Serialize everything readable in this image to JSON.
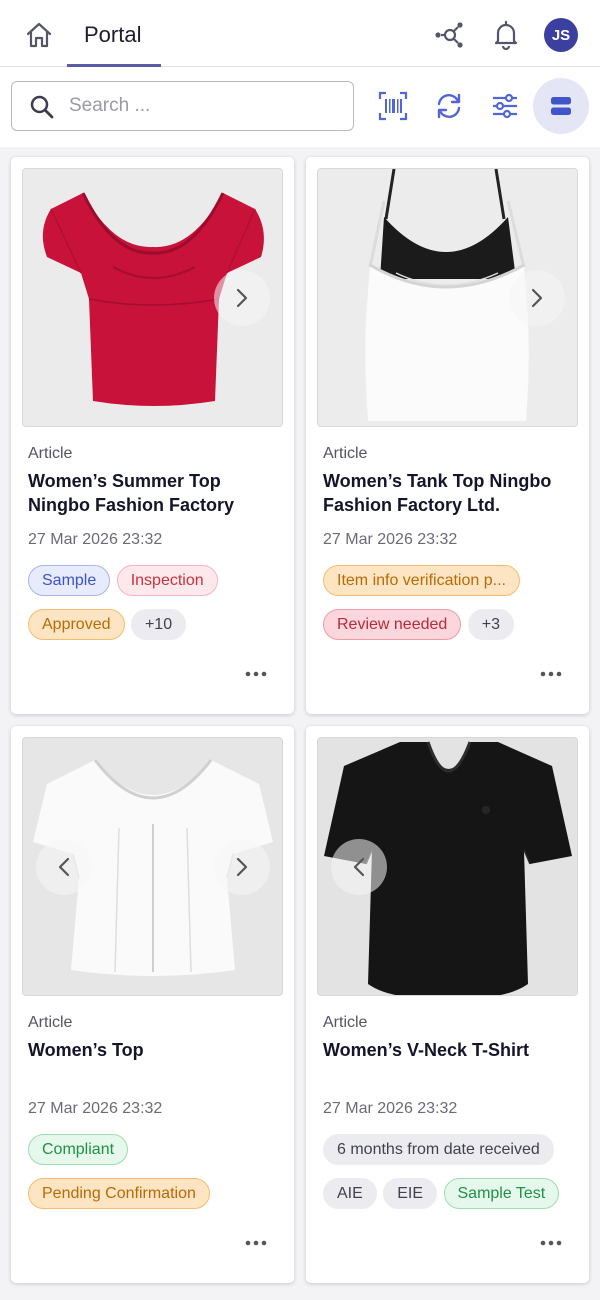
{
  "header": {
    "tab_label": "Portal",
    "avatar_initials": "JS",
    "icons": [
      "home-icon",
      "network-icon",
      "bell-icon"
    ]
  },
  "toolbar": {
    "search_placeholder": "Search ...",
    "search_value": "",
    "icons": [
      "barcode-scan-icon",
      "refresh-icon",
      "filter-sliders-icon",
      "list-view-icon"
    ]
  },
  "colors": {
    "accent": "#3b3f9f",
    "tab_underline": "#5a5ca8",
    "view_toggle_bg": "#e4e6f5"
  },
  "cards": [
    {
      "type": "Article",
      "title": "Women’s Summer Top Ningbo Fashion Factory",
      "date": "27 Mar 2026 23:32",
      "image": "red-puff-sleeve-top",
      "nav": [
        "next"
      ],
      "tags": [
        {
          "label": "Sample",
          "style": "blue"
        },
        {
          "label": "Inspection",
          "style": "red"
        },
        {
          "label": "Approved",
          "style": "orange"
        },
        {
          "label": "+10",
          "style": "gray"
        }
      ]
    },
    {
      "type": "Article",
      "title": "Women’s Tank Top Ningbo Fashion Factory Ltd.",
      "date": "27 Mar 2026 23:32",
      "image": "white-black-camisole",
      "nav": [
        "next"
      ],
      "tags": [
        {
          "label": "Item info verification p...",
          "style": "orange"
        },
        {
          "label": "Review needed",
          "style": "redstrong"
        },
        {
          "label": "+3",
          "style": "gray"
        }
      ]
    },
    {
      "type": "Article",
      "title": "Women’s Top",
      "date": "27 Mar 2026 23:32",
      "image": "white-corset-top",
      "nav": [
        "prev",
        "next"
      ],
      "tags": [
        {
          "label": "Compliant",
          "style": "green"
        },
        {
          "label": "Pending Confirmation",
          "style": "orange"
        }
      ]
    },
    {
      "type": "Article",
      "title": "Women’s V-Neck T-Shirt",
      "date": "27 Mar 2026 23:32",
      "image": "black-vneck-tshirt",
      "nav": [
        "prev"
      ],
      "tags": [
        {
          "label": "6 months from date received",
          "style": "gray"
        },
        {
          "label": "AIE",
          "style": "gray"
        },
        {
          "label": "EIE",
          "style": "gray"
        },
        {
          "label": "Sample Test",
          "style": "green"
        }
      ]
    }
  ]
}
